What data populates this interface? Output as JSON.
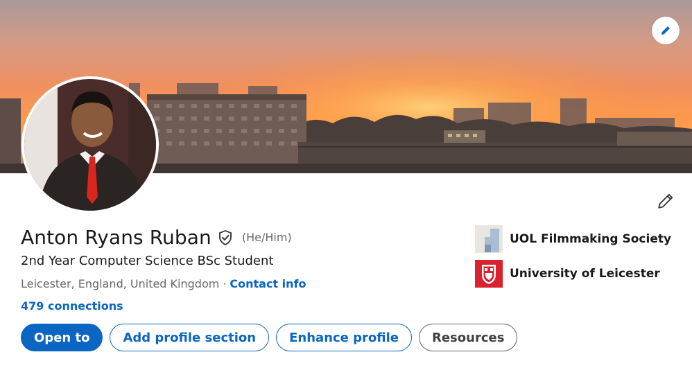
{
  "profile": {
    "name": "Anton Ryans Ruban",
    "pronouns": "(He/Him)",
    "headline": "2nd Year Computer Science BSc Student",
    "location": "Leicester, England, United Kingdom",
    "separator": "·",
    "contact_info_label": "Contact info",
    "connections_label": "479 connections"
  },
  "actions": {
    "open_to": "Open to",
    "add_profile_section": "Add profile section",
    "enhance_profile": "Enhance profile",
    "resources": "Resources"
  },
  "organizations": [
    {
      "name": "UOL Filmmaking Society",
      "icon": "filmmaking-society-logo"
    },
    {
      "name": "University of Leicester",
      "icon": "university-of-leicester-logo"
    }
  ],
  "icons": {
    "banner_edit": "pencil-icon",
    "intro_edit": "pencil-icon",
    "verified": "shield-check-icon"
  },
  "colors": {
    "accent": "#0a66c2",
    "leicester_red": "#d8222d",
    "text_primary": "rgba(0,0,0,0.9)",
    "text_secondary": "rgba(0,0,0,0.6)"
  }
}
